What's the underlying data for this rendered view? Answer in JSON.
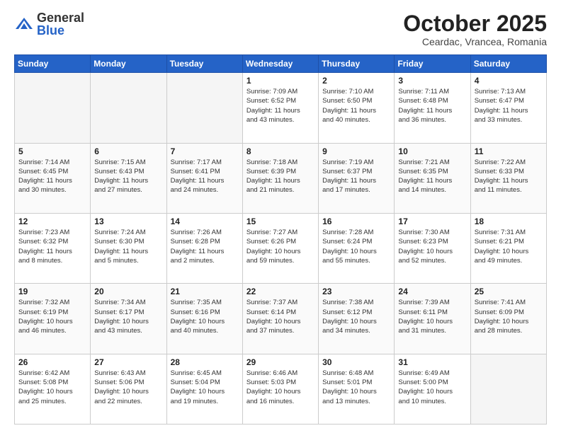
{
  "header": {
    "logo_general": "General",
    "logo_blue": "Blue",
    "month_title": "October 2025",
    "location": "Ceardac, Vrancea, Romania"
  },
  "weekdays": [
    "Sunday",
    "Monday",
    "Tuesday",
    "Wednesday",
    "Thursday",
    "Friday",
    "Saturday"
  ],
  "rows": [
    {
      "cells": [
        {
          "empty": true
        },
        {
          "empty": true
        },
        {
          "empty": true
        },
        {
          "day": 1,
          "info": "Sunrise: 7:09 AM\nSunset: 6:52 PM\nDaylight: 11 hours\nand 43 minutes."
        },
        {
          "day": 2,
          "info": "Sunrise: 7:10 AM\nSunset: 6:50 PM\nDaylight: 11 hours\nand 40 minutes."
        },
        {
          "day": 3,
          "info": "Sunrise: 7:11 AM\nSunset: 6:48 PM\nDaylight: 11 hours\nand 36 minutes."
        },
        {
          "day": 4,
          "info": "Sunrise: 7:13 AM\nSunset: 6:47 PM\nDaylight: 11 hours\nand 33 minutes."
        }
      ]
    },
    {
      "cells": [
        {
          "day": 5,
          "info": "Sunrise: 7:14 AM\nSunset: 6:45 PM\nDaylight: 11 hours\nand 30 minutes."
        },
        {
          "day": 6,
          "info": "Sunrise: 7:15 AM\nSunset: 6:43 PM\nDaylight: 11 hours\nand 27 minutes."
        },
        {
          "day": 7,
          "info": "Sunrise: 7:17 AM\nSunset: 6:41 PM\nDaylight: 11 hours\nand 24 minutes."
        },
        {
          "day": 8,
          "info": "Sunrise: 7:18 AM\nSunset: 6:39 PM\nDaylight: 11 hours\nand 21 minutes."
        },
        {
          "day": 9,
          "info": "Sunrise: 7:19 AM\nSunset: 6:37 PM\nDaylight: 11 hours\nand 17 minutes."
        },
        {
          "day": 10,
          "info": "Sunrise: 7:21 AM\nSunset: 6:35 PM\nDaylight: 11 hours\nand 14 minutes."
        },
        {
          "day": 11,
          "info": "Sunrise: 7:22 AM\nSunset: 6:33 PM\nDaylight: 11 hours\nand 11 minutes."
        }
      ]
    },
    {
      "cells": [
        {
          "day": 12,
          "info": "Sunrise: 7:23 AM\nSunset: 6:32 PM\nDaylight: 11 hours\nand 8 minutes."
        },
        {
          "day": 13,
          "info": "Sunrise: 7:24 AM\nSunset: 6:30 PM\nDaylight: 11 hours\nand 5 minutes."
        },
        {
          "day": 14,
          "info": "Sunrise: 7:26 AM\nSunset: 6:28 PM\nDaylight: 11 hours\nand 2 minutes."
        },
        {
          "day": 15,
          "info": "Sunrise: 7:27 AM\nSunset: 6:26 PM\nDaylight: 10 hours\nand 59 minutes."
        },
        {
          "day": 16,
          "info": "Sunrise: 7:28 AM\nSunset: 6:24 PM\nDaylight: 10 hours\nand 55 minutes."
        },
        {
          "day": 17,
          "info": "Sunrise: 7:30 AM\nSunset: 6:23 PM\nDaylight: 10 hours\nand 52 minutes."
        },
        {
          "day": 18,
          "info": "Sunrise: 7:31 AM\nSunset: 6:21 PM\nDaylight: 10 hours\nand 49 minutes."
        }
      ]
    },
    {
      "cells": [
        {
          "day": 19,
          "info": "Sunrise: 7:32 AM\nSunset: 6:19 PM\nDaylight: 10 hours\nand 46 minutes."
        },
        {
          "day": 20,
          "info": "Sunrise: 7:34 AM\nSunset: 6:17 PM\nDaylight: 10 hours\nand 43 minutes."
        },
        {
          "day": 21,
          "info": "Sunrise: 7:35 AM\nSunset: 6:16 PM\nDaylight: 10 hours\nand 40 minutes."
        },
        {
          "day": 22,
          "info": "Sunrise: 7:37 AM\nSunset: 6:14 PM\nDaylight: 10 hours\nand 37 minutes."
        },
        {
          "day": 23,
          "info": "Sunrise: 7:38 AM\nSunset: 6:12 PM\nDaylight: 10 hours\nand 34 minutes."
        },
        {
          "day": 24,
          "info": "Sunrise: 7:39 AM\nSunset: 6:11 PM\nDaylight: 10 hours\nand 31 minutes."
        },
        {
          "day": 25,
          "info": "Sunrise: 7:41 AM\nSunset: 6:09 PM\nDaylight: 10 hours\nand 28 minutes."
        }
      ]
    },
    {
      "cells": [
        {
          "day": 26,
          "info": "Sunrise: 6:42 AM\nSunset: 5:08 PM\nDaylight: 10 hours\nand 25 minutes."
        },
        {
          "day": 27,
          "info": "Sunrise: 6:43 AM\nSunset: 5:06 PM\nDaylight: 10 hours\nand 22 minutes."
        },
        {
          "day": 28,
          "info": "Sunrise: 6:45 AM\nSunset: 5:04 PM\nDaylight: 10 hours\nand 19 minutes."
        },
        {
          "day": 29,
          "info": "Sunrise: 6:46 AM\nSunset: 5:03 PM\nDaylight: 10 hours\nand 16 minutes."
        },
        {
          "day": 30,
          "info": "Sunrise: 6:48 AM\nSunset: 5:01 PM\nDaylight: 10 hours\nand 13 minutes."
        },
        {
          "day": 31,
          "info": "Sunrise: 6:49 AM\nSunset: 5:00 PM\nDaylight: 10 hours\nand 10 minutes."
        },
        {
          "empty": true
        }
      ]
    }
  ]
}
